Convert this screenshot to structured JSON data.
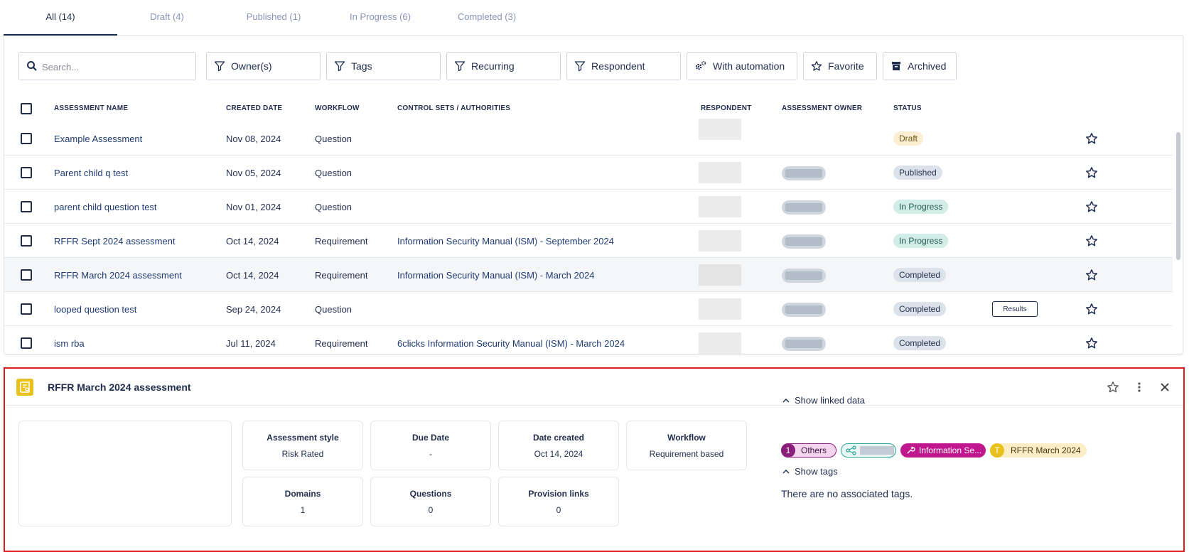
{
  "tabs": [
    {
      "label": "All (14)",
      "active": true
    },
    {
      "label": "Draft (4)"
    },
    {
      "label": "Published (1)"
    },
    {
      "label": "In Progress (6)"
    },
    {
      "label": "Completed (3)"
    }
  ],
  "filters": {
    "search_placeholder": "Search...",
    "owner": "Owner(s)",
    "tags": "Tags",
    "recurring": "Recurring",
    "respondent": "Respondent",
    "automation": "With automation",
    "favorite": "Favorite",
    "archived": "Archived"
  },
  "columns": {
    "name": "ASSESSMENT NAME",
    "created": "CREATED DATE",
    "workflow": "WORKFLOW",
    "controls": "CONTROL SETS / AUTHORITIES",
    "respondent": "RESPONDENT",
    "owner": "ASSESSMENT OWNER",
    "status": "STATUS"
  },
  "rows": [
    {
      "name": "Example Assessment",
      "created": "Nov 08, 2024",
      "workflow": "Question",
      "controls": "",
      "status": "Draft",
      "status_kind": "draft"
    },
    {
      "name": "Parent child q test",
      "created": "Nov 05, 2024",
      "workflow": "Question",
      "controls": "",
      "status": "Published",
      "status_kind": "pub"
    },
    {
      "name": "parent child question test",
      "created": "Nov 01, 2024",
      "workflow": "Question",
      "controls": "",
      "status": "In Progress",
      "status_kind": "prog"
    },
    {
      "name": "RFFR Sept 2024 assessment",
      "created": "Oct 14, 2024",
      "workflow": "Requirement",
      "controls": "Information Security Manual (ISM) - September 2024",
      "status": "In Progress",
      "status_kind": "prog"
    },
    {
      "name": "RFFR March 2024 assessment",
      "created": "Oct 14, 2024",
      "workflow": "Requirement",
      "controls": "Information Security Manual (ISM) - March 2024",
      "status": "Completed",
      "status_kind": "comp"
    },
    {
      "name": "looped question test",
      "created": "Sep 24, 2024",
      "workflow": "Question",
      "controls": "",
      "status": "Completed",
      "status_kind": "comp",
      "action": "Results"
    },
    {
      "name": "ism rba",
      "created": "Jul 11, 2024",
      "workflow": "Requirement",
      "controls": "6clicks Information Security Manual (ISM) - March 2024",
      "status": "Completed",
      "status_kind": "comp"
    }
  ],
  "detail": {
    "title": "RFFR March 2024 assessment",
    "cards": [
      {
        "label": "Assessment style",
        "value": "Risk Rated"
      },
      {
        "label": "Due Date",
        "value": "-"
      },
      {
        "label": "Date created",
        "value": "Oct 14, 2024"
      },
      {
        "label": "Workflow",
        "value": "Requirement based"
      },
      {
        "label": "Domains",
        "value": "1"
      },
      {
        "label": "Questions",
        "value": "0"
      },
      {
        "label": "Provision links",
        "value": "0"
      }
    ],
    "show_linked": "Show linked data",
    "show_tags": "Show tags",
    "chips": {
      "others_count": "1",
      "others_label": "Others",
      "info_label": "Information Se...",
      "t_letter": "T",
      "t_label": "RFFR March 2024"
    },
    "no_tags": "There are no associated tags."
  },
  "colors": {
    "navy": "#1f2d4d",
    "draft_bg": "#fbeed2",
    "progress_bg": "#d2ece6",
    "completed_bg": "#dbe2ea",
    "highlight_border": "#e31b1b",
    "accent_yellow": "#e8c21a",
    "chip_magenta": "#c0178f"
  }
}
